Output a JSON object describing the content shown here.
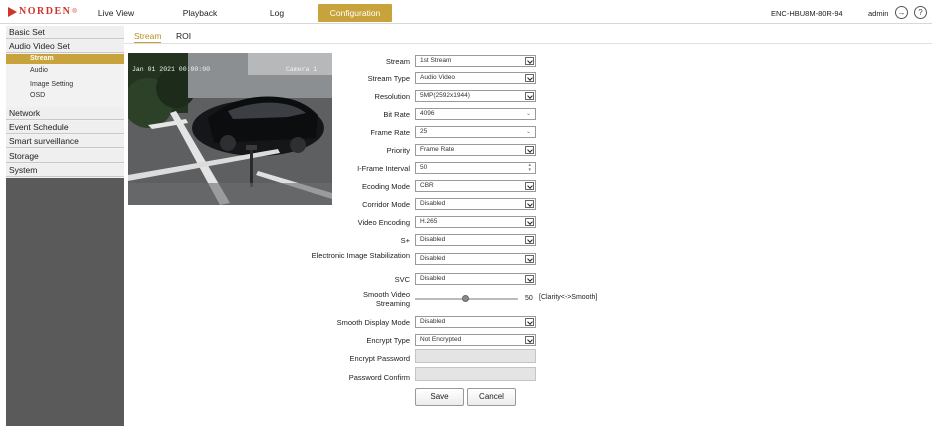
{
  "brand": {
    "name": "NORDEN",
    "reg": "®",
    "color": "#d0332a"
  },
  "nav": [
    {
      "label": "Live View"
    },
    {
      "label": "Playback"
    },
    {
      "label": "Log"
    },
    {
      "label": "Configuration",
      "active": true
    }
  ],
  "header": {
    "device": "ENC-HBU8M-80R-94",
    "user": "admin",
    "logout_icon": "logout-icon",
    "help_icon": "help-icon"
  },
  "sidebar": {
    "sections": [
      "Basic Set",
      "Audio Video Set",
      "Network",
      "Event Schedule",
      "Smart surveillance",
      "Storage",
      "System"
    ],
    "audio_video_items": [
      "Stream",
      "Audio",
      "Image Setting",
      "OSD"
    ],
    "active_item": "Stream"
  },
  "tabs": [
    "Stream",
    "ROI"
  ],
  "preview": {
    "timestamp": "Jan 01 2021 00:00:00",
    "camera": "Camera 1"
  },
  "form": {
    "fields": [
      {
        "label": "Stream",
        "value": "1st Stream",
        "kind": "select"
      },
      {
        "label": "Stream Type",
        "value": "Audio Video",
        "kind": "select"
      },
      {
        "label": "Resolution",
        "value": "5MP(2592x1944)",
        "kind": "select"
      },
      {
        "label": "Bit Rate",
        "value": "4096",
        "kind": "combo"
      },
      {
        "label": "Frame Rate",
        "value": "25",
        "kind": "combo"
      },
      {
        "label": "Priority",
        "value": "Frame Rate",
        "kind": "select"
      },
      {
        "label": "I-Frame Interval",
        "value": "50",
        "kind": "spin"
      },
      {
        "label": "Ecoding Mode",
        "value": "CBR",
        "kind": "select"
      },
      {
        "label": "Corridor Mode",
        "value": "Disabled",
        "kind": "select"
      },
      {
        "label": "Video Encoding",
        "value": "H.265",
        "kind": "select"
      },
      {
        "label": "S+",
        "value": "Disabled",
        "kind": "select"
      },
      {
        "label": "Electronic Image Stabilization",
        "value": "Disabled",
        "kind": "select"
      },
      {
        "label": "SVC",
        "value": "Disabled",
        "kind": "select"
      },
      {
        "label": "Smooth Display Mode",
        "value": "Disabled",
        "kind": "select"
      },
      {
        "label": "Encrypt Type",
        "value": "Not Encrypted",
        "kind": "select"
      },
      {
        "label": "Encrypt Password",
        "value": "",
        "kind": "disabled"
      },
      {
        "label": "Password Confirm",
        "value": "",
        "kind": "disabled"
      }
    ],
    "smooth_streaming": {
      "label": "Smooth Video Streaming",
      "value": "50",
      "hint": "[Clarity<->Smooth]",
      "fraction": 0.5
    },
    "save_label": "Save",
    "cancel_label": "Cancel"
  },
  "colors": {
    "accent": "#c8a23a",
    "sidebar_bg": "#5a5a5a"
  }
}
